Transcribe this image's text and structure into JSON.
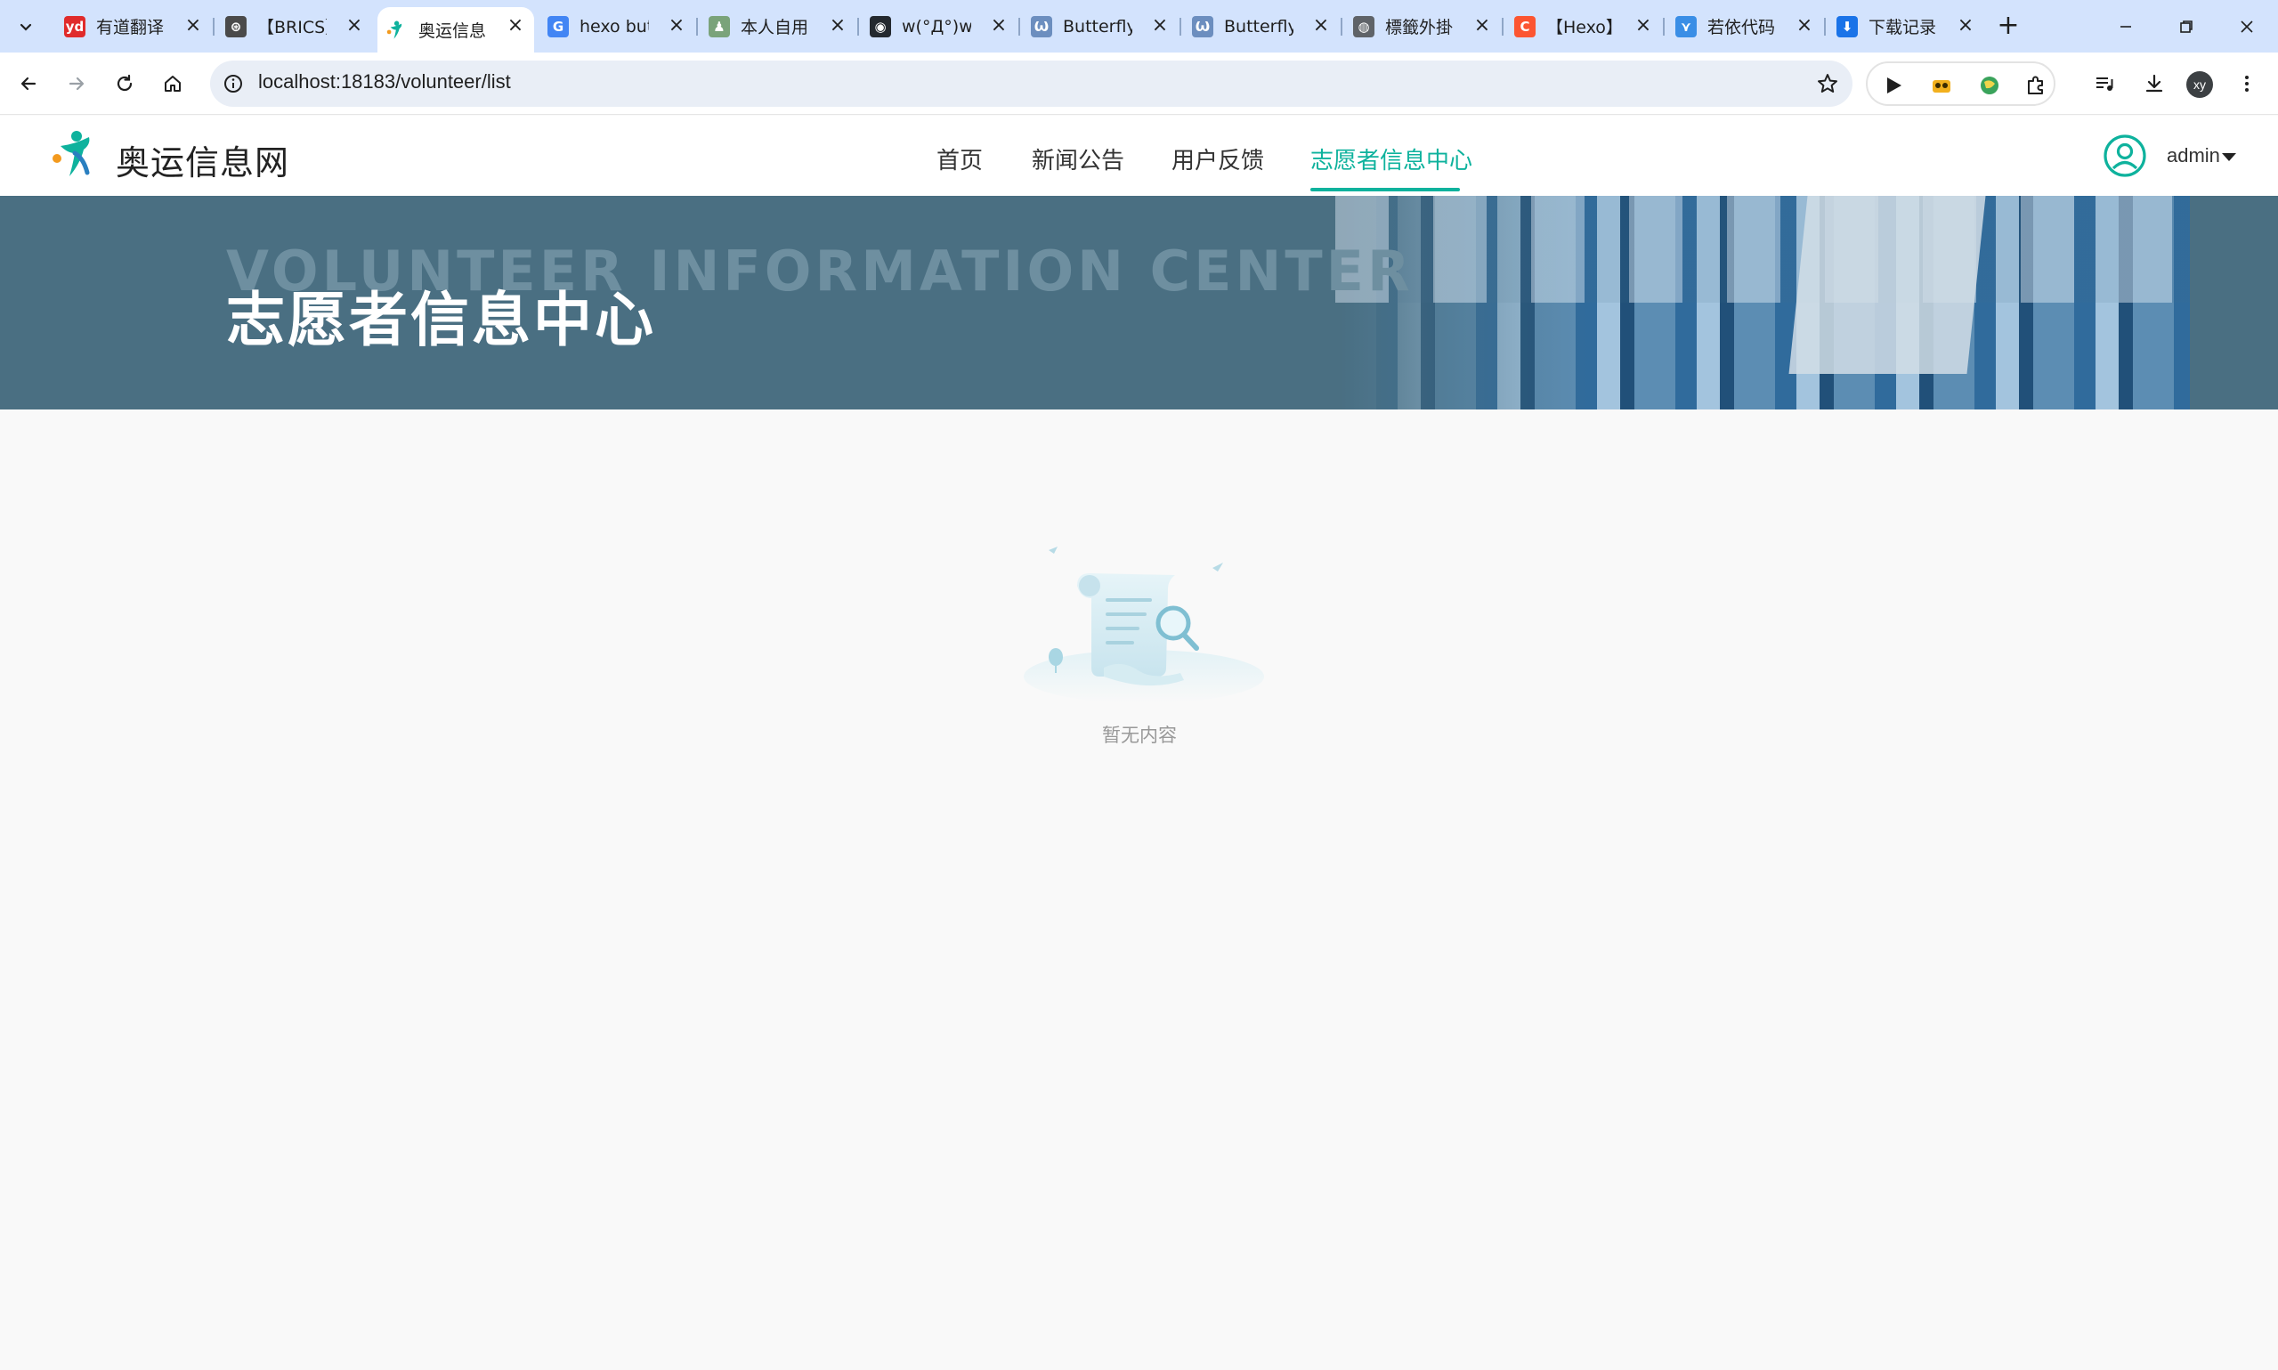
{
  "browser": {
    "tabs": [
      {
        "title": "有道翻译",
        "favicon": "youdao-icon",
        "fav_color": "#e02b2b",
        "fav_text": "yd"
      },
      {
        "title": "【BRICS】",
        "favicon": "brics-icon",
        "fav_color": "#4a4a4a",
        "fav_text": "⊛"
      },
      {
        "title": "奥运信息",
        "favicon": "olympic-site-icon",
        "fav_color": "#0eb29d",
        "fav_text": "",
        "active": true
      },
      {
        "title": "hexo butterfly",
        "favicon": "google-icon",
        "fav_color": "#4285f4",
        "fav_text": "G"
      },
      {
        "title": "本人自用",
        "favicon": "person-icon",
        "fav_color": "#7aa37a",
        "fav_text": "♟"
      },
      {
        "title": "w(°Д°)w",
        "favicon": "github-icon",
        "fav_color": "#24292f",
        "fav_text": "◉"
      },
      {
        "title": "Butterfly",
        "favicon": "butterfly-icon",
        "fav_color": "#6c8ebf",
        "fav_text": "Ѡ"
      },
      {
        "title": "Butterfly",
        "favicon": "butterfly-icon",
        "fav_color": "#6c8ebf",
        "fav_text": "Ѡ"
      },
      {
        "title": "標籤外掛",
        "favicon": "globe-icon",
        "fav_color": "#5f6368",
        "fav_text": "◍"
      },
      {
        "title": "【Hexo】",
        "favicon": "csdn-icon",
        "fav_color": "#fc5531",
        "fav_text": "C"
      },
      {
        "title": "若依代码",
        "favicon": "ruoyi-icon",
        "fav_color": "#3a8ee6",
        "fav_text": "⋎"
      },
      {
        "title": "下载记录",
        "favicon": "download-icon",
        "fav_color": "#1a73e8",
        "fav_text": "⬇"
      }
    ],
    "url": "localhost:18183/volunteer/list",
    "profile_initials": "xy"
  },
  "site": {
    "logo_text": "奥运信息网",
    "nav": [
      "首页",
      "新闻公告",
      "用户反馈",
      "志愿者信息中心"
    ],
    "active_nav_index": 3,
    "user_name": "admin",
    "accent_color": "#0eb29d"
  },
  "banner": {
    "title": "志愿者信息中心",
    "subtitle_en": "VOLUNTEER INFORMATION CENTER",
    "bg_color": "#4a6f82"
  },
  "empty_state": {
    "text": "暂无内容",
    "icon": "empty-document-search-icon"
  }
}
